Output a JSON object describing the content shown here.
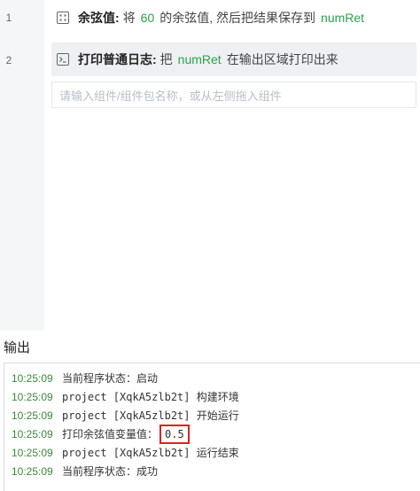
{
  "editor": {
    "line_numbers": [
      "1",
      "2"
    ],
    "blocks": [
      {
        "icon": "function-grid-icon",
        "title": "余弦值:",
        "parts": [
          {
            "kind": "text",
            "value": "将"
          },
          {
            "kind": "var",
            "value": "60"
          },
          {
            "kind": "text",
            "value": "的余弦值, 然后把结果保存到"
          },
          {
            "kind": "var",
            "value": "numRet"
          }
        ]
      },
      {
        "icon": "terminal-icon",
        "title": "打印普通日志:",
        "parts": [
          {
            "kind": "text",
            "value": "把"
          },
          {
            "kind": "var",
            "value": "numRet"
          },
          {
            "kind": "text",
            "value": "在输出区域打印出来"
          }
        ]
      }
    ],
    "drop_placeholder": "请输入组件/组件包名称，或从左侧拖入组件"
  },
  "output": {
    "title": "输出",
    "logs": [
      {
        "time": "10:25:09",
        "msg": "当前程序状态：启动"
      },
      {
        "time": "10:25:09",
        "msg": "project [XqkA5zlb2t] 构建环境"
      },
      {
        "time": "10:25:09",
        "msg": "project [XqkA5zlb2t] 开始运行"
      },
      {
        "time": "10:25:09",
        "msg": "打印余弦值变量值：",
        "highlight": "0.5"
      },
      {
        "time": "10:25:09",
        "msg": "project [XqkA5zlb2t] 运行结束"
      },
      {
        "time": "10:25:09",
        "msg": "当前程序状态：成功"
      }
    ]
  },
  "colors": {
    "variable": "#2aa14b",
    "timestamp": "#3a8a3a",
    "highlight_border": "#e02020",
    "gutter": "#f5f6f8",
    "selected_block": "#eef0f4"
  }
}
